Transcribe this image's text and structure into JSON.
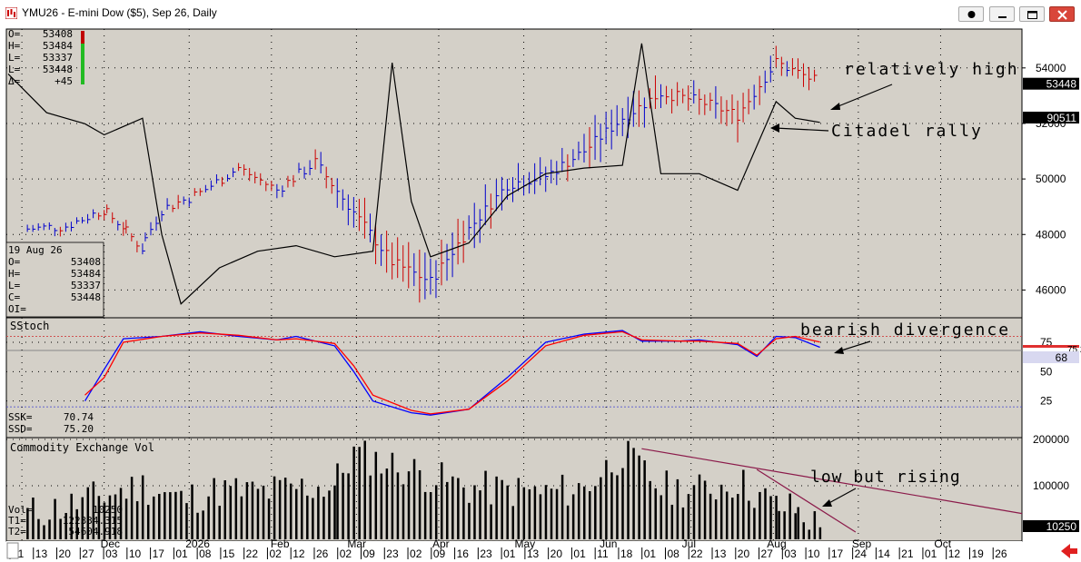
{
  "window": {
    "title": "YMU26 - E-mini Dow ($5), Sep 26, Daily"
  },
  "colors": {
    "background": "#d4d0c8",
    "up_bar": "#0000cc",
    "down_bar": "#cc0000",
    "line": "#000000",
    "stoch_k": "#0000ff",
    "stoch_d": "#ff0000",
    "annotation_line": "#8b1a4a"
  },
  "price_panel": {
    "ohlc_header": [
      {
        "label": "O=",
        "value": "53408"
      },
      {
        "label": "H=",
        "value": "53484"
      },
      {
        "label": "L=",
        "value": "53337"
      },
      {
        "label": "L=",
        "value": "53448"
      },
      {
        "label": "Δ=",
        "value": "+45"
      }
    ],
    "data_window": {
      "date": "19 Aug 26",
      "rows": [
        {
          "label": "O=",
          "value": "53408"
        },
        {
          "label": "H=",
          "value": "53484"
        },
        {
          "label": "L=",
          "value": "53337"
        },
        {
          "label": "C=",
          "value": "53448"
        },
        {
          "label": "OI=",
          "value": ""
        }
      ]
    },
    "y_ticks": [
      "54000",
      "52000",
      "50000",
      "48000",
      "46000"
    ],
    "price_marker": "53448",
    "line_marker": "90511",
    "annotations": [
      "relatively high",
      "Citadel rally"
    ]
  },
  "stoch_panel": {
    "title": "SStoch",
    "y_ticks": [
      "75",
      "50",
      "25"
    ],
    "marker_top": "75.2",
    "marker": "68",
    "readout": [
      {
        "label": "SSK=",
        "value": "70.74"
      },
      {
        "label": "SSD=",
        "value": "75.20"
      }
    ],
    "annotation": "bearish divergence"
  },
  "volume_panel": {
    "title": "Commodity Exchange Vol",
    "y_ticks": [
      "200000",
      "100000"
    ],
    "marker": "10250",
    "readout": [
      {
        "label": "Vol=",
        "value": "10250"
      },
      {
        "label": "T1=",
        "value": "122334.315"
      },
      {
        "label": "T2=",
        "value": "54604.918"
      }
    ],
    "annotation": "low but rising"
  },
  "x_axis": {
    "day_labels": [
      "01",
      "13",
      "20",
      "27",
      "03",
      "10",
      "17",
      "01",
      "08",
      "15",
      "22",
      "02",
      "12",
      "26",
      "02",
      "09",
      "23",
      "02",
      "09",
      "16",
      "23",
      "01",
      "13",
      "20",
      "01",
      "11",
      "18",
      "01",
      "08",
      "22",
      "13",
      "20",
      "27",
      "03",
      "10",
      "17",
      "24",
      "14",
      "21",
      "01",
      "12",
      "19",
      "26"
    ],
    "month_labels": [
      "Dec",
      "2026",
      "Feb",
      "Mar",
      "Apr",
      "May",
      "Jun",
      "Jul",
      "Aug",
      "Sep",
      "Oct"
    ]
  },
  "chart_data": [
    {
      "type": "line",
      "title": "YMU26 - E-mini Dow ($5), Sep 26, Daily",
      "x_range": [
        "2025-10-27",
        "2026-10-31"
      ],
      "ylim": [
        45000,
        55400
      ],
      "series": [
        {
          "kind": "ohlc_bars",
          "points": [
            {
              "date": "2025-11-03",
              "high": 48300,
              "low": 48000,
              "close": 48200,
              "color": "up"
            },
            {
              "date": "2025-11-17",
              "high": 48400,
              "low": 48100,
              "close": 48300,
              "color": "up"
            },
            {
              "date": "2025-12-01",
              "high": 49000,
              "low": 48700,
              "close": 48900,
              "color": "up"
            },
            {
              "date": "2025-12-08",
              "high": 48500,
              "low": 48100,
              "close": 48300,
              "color": "down"
            },
            {
              "date": "2025-12-15",
              "high": 47700,
              "low": 47300,
              "close": 47500,
              "color": "down"
            },
            {
              "date": "2025-12-22",
              "high": 49100,
              "low": 48700,
              "close": 48900,
              "color": "up"
            },
            {
              "date": "2026-01-05",
              "high": 49700,
              "low": 49300,
              "close": 49500,
              "color": "up"
            },
            {
              "date": "2026-01-19",
              "high": 50500,
              "low": 50200,
              "close": 50400,
              "color": "up"
            },
            {
              "date": "2026-02-02",
              "high": 49800,
              "low": 49400,
              "close": 49600,
              "color": "down"
            },
            {
              "date": "2026-02-16",
              "high": 50800,
              "low": 50300,
              "close": 50600,
              "color": "up"
            },
            {
              "date": "2026-03-02",
              "high": 49800,
              "low": 48500,
              "close": 48800,
              "color": "down"
            },
            {
              "date": "2026-03-16",
              "high": 48100,
              "low": 46800,
              "close": 47000,
              "color": "down"
            },
            {
              "date": "2026-03-30",
              "high": 47400,
              "low": 45700,
              "close": 46300,
              "color": "down"
            },
            {
              "date": "2026-04-13",
              "high": 48600,
              "low": 47200,
              "close": 48200,
              "color": "up"
            },
            {
              "date": "2026-04-27",
              "high": 50300,
              "low": 49100,
              "close": 49800,
              "color": "up"
            },
            {
              "date": "2026-05-11",
              "high": 50600,
              "low": 49800,
              "close": 50100,
              "color": "up"
            },
            {
              "date": "2026-05-25",
              "high": 51400,
              "low": 50400,
              "close": 51000,
              "color": "up"
            },
            {
              "date": "2026-06-08",
              "high": 52700,
              "low": 51200,
              "close": 52200,
              "color": "up"
            },
            {
              "date": "2026-06-22",
              "high": 53400,
              "low": 52500,
              "close": 53100,
              "color": "up"
            },
            {
              "date": "2026-07-06",
              "high": 53200,
              "low": 52500,
              "close": 52800,
              "color": "up"
            },
            {
              "date": "2026-07-20",
              "high": 52900,
              "low": 51800,
              "close": 52300,
              "color": "down"
            },
            {
              "date": "2026-08-03",
              "high": 54900,
              "low": 53700,
              "close": 54200,
              "color": "up"
            },
            {
              "date": "2026-08-19",
              "high": 53484,
              "low": 53337,
              "close": 53448,
              "color": "up"
            }
          ]
        },
        {
          "kind": "line",
          "points": [
            [
              "2025-10-27",
              0.88
            ],
            [
              "2025-11-10",
              0.74
            ],
            [
              "2025-11-24",
              0.7
            ],
            [
              "2025-12-01",
              0.66
            ],
            [
              "2025-12-15",
              0.72
            ],
            [
              "2025-12-22",
              0.3
            ],
            [
              "2025-12-29",
              0.05
            ],
            [
              "2026-01-12",
              0.18
            ],
            [
              "2026-01-26",
              0.24
            ],
            [
              "2026-02-09",
              0.26
            ],
            [
              "2026-02-23",
              0.22
            ],
            [
              "2026-03-09",
              0.24
            ],
            [
              "2026-03-16",
              0.92
            ],
            [
              "2026-03-23",
              0.42
            ],
            [
              "2026-03-30",
              0.22
            ],
            [
              "2026-04-13",
              0.27
            ],
            [
              "2026-04-27",
              0.44
            ],
            [
              "2026-05-11",
              0.52
            ],
            [
              "2026-05-25",
              0.54
            ],
            [
              "2026-06-08",
              0.55
            ],
            [
              "2026-06-15",
              0.99
            ],
            [
              "2026-06-22",
              0.52
            ],
            [
              "2026-07-06",
              0.52
            ],
            [
              "2026-07-20",
              0.46
            ],
            [
              "2026-08-03",
              0.78
            ],
            [
              "2026-08-10",
              0.72
            ],
            [
              "2026-08-19",
              0.705
            ]
          ]
        }
      ],
      "annotations": [
        "relatively high",
        "Citadel rally"
      ]
    },
    {
      "type": "line",
      "title": "SStoch",
      "ylim": [
        0,
        100
      ],
      "series": [
        {
          "name": "SSK",
          "points": [
            [
              "2025-11-24",
              25
            ],
            [
              "2025-12-01",
              52
            ],
            [
              "2025-12-08",
              78
            ],
            [
              "2025-12-22",
              80
            ],
            [
              "2026-01-05",
              84
            ],
            [
              "2026-01-19",
              80
            ],
            [
              "2026-02-02",
              77
            ],
            [
              "2026-02-09",
              80
            ],
            [
              "2026-02-23",
              72
            ],
            [
              "2026-03-02",
              50
            ],
            [
              "2026-03-09",
              25
            ],
            [
              "2026-03-23",
              15
            ],
            [
              "2026-03-30",
              13
            ],
            [
              "2026-04-13",
              18
            ],
            [
              "2026-04-27",
              45
            ],
            [
              "2026-05-11",
              75
            ],
            [
              "2026-05-25",
              82
            ],
            [
              "2026-06-08",
              85
            ],
            [
              "2026-06-15",
              76
            ],
            [
              "2026-06-29",
              76
            ],
            [
              "2026-07-06",
              77
            ],
            [
              "2026-07-20",
              73
            ],
            [
              "2026-07-27",
              63
            ],
            [
              "2026-08-03",
              80
            ],
            [
              "2026-08-10",
              79
            ],
            [
              "2026-08-19",
              70.74
            ]
          ]
        },
        {
          "name": "SSD",
          "points": [
            [
              "2025-11-24",
              30
            ],
            [
              "2025-12-01",
              45
            ],
            [
              "2025-12-08",
              75
            ],
            [
              "2025-12-22",
              80
            ],
            [
              "2026-01-05",
              83
            ],
            [
              "2026-01-19",
              81
            ],
            [
              "2026-02-02",
              77
            ],
            [
              "2026-02-09",
              78
            ],
            [
              "2026-02-23",
              74
            ],
            [
              "2026-03-02",
              55
            ],
            [
              "2026-03-09",
              30
            ],
            [
              "2026-03-23",
              17
            ],
            [
              "2026-03-30",
              14
            ],
            [
              "2026-04-13",
              18
            ],
            [
              "2026-04-27",
              42
            ],
            [
              "2026-05-11",
              72
            ],
            [
              "2026-05-25",
              81
            ],
            [
              "2026-06-08",
              84
            ],
            [
              "2026-06-15",
              77
            ],
            [
              "2026-06-29",
              76
            ],
            [
              "2026-07-06",
              76
            ],
            [
              "2026-07-20",
              74
            ],
            [
              "2026-07-27",
              64
            ],
            [
              "2026-08-03",
              78
            ],
            [
              "2026-08-10",
              80
            ],
            [
              "2026-08-19",
              75.2
            ]
          ]
        }
      ],
      "annotations": [
        "bearish divergence"
      ]
    },
    {
      "type": "bar",
      "title": "Commodity Exchange Vol",
      "ylim": [
        0,
        250000
      ],
      "series": [
        {
          "name": "Vol",
          "points": [
            [
              "2025-11-03",
              40000
            ],
            [
              "2025-11-17",
              55000
            ],
            [
              "2025-12-01",
              80000
            ],
            [
              "2025-12-15",
              100000
            ],
            [
              "2025-12-29",
              70000
            ],
            [
              "2026-01-12",
              90000
            ],
            [
              "2026-01-26",
              85000
            ],
            [
              "2026-02-09",
              95000
            ],
            [
              "2026-02-23",
              100000
            ],
            [
              "2026-03-02",
              170000
            ],
            [
              "2026-03-16",
              145000
            ],
            [
              "2026-03-30",
              120000
            ],
            [
              "2026-04-13",
              95000
            ],
            [
              "2026-04-27",
              90000
            ],
            [
              "2026-05-11",
              85000
            ],
            [
              "2026-05-25",
              95000
            ],
            [
              "2026-06-08",
              170000
            ],
            [
              "2026-06-22",
              95000
            ],
            [
              "2026-07-06",
              90000
            ],
            [
              "2026-07-20",
              110000
            ],
            [
              "2026-08-03",
              55000
            ],
            [
              "2026-08-10",
              50000
            ],
            [
              "2026-08-19",
              10250
            ]
          ]
        }
      ],
      "annotations": [
        "low but rising"
      ]
    }
  ]
}
